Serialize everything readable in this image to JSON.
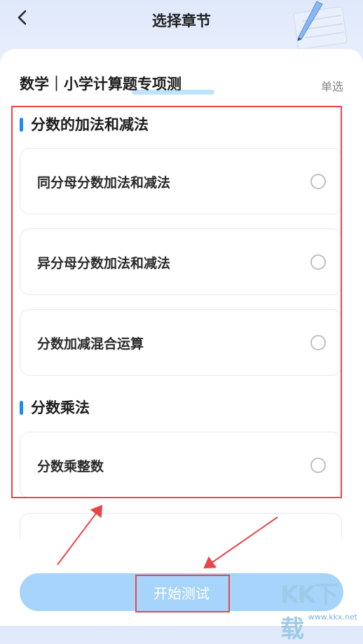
{
  "header": {
    "title": "选择章节",
    "back_icon": "chevron-left-icon",
    "decoration_icon": "pen-icon"
  },
  "subject": {
    "title": "数学｜小学计算题专项测",
    "mode": "单选"
  },
  "sections": [
    {
      "label": "分数的加法和减法",
      "items": [
        {
          "label": "同分母分数加法和减法",
          "selected": false
        },
        {
          "label": "异分母分数加法和减法",
          "selected": false
        },
        {
          "label": "分数加减混合运算",
          "selected": false
        }
      ]
    },
    {
      "label": "分数乘法",
      "items": [
        {
          "label": "分数乘整数",
          "selected": false
        }
      ]
    }
  ],
  "footer": {
    "start_label": "开始测试"
  },
  "watermark": {
    "text": "KK下载",
    "url": "www.kkx.net"
  },
  "colors": {
    "accent": "#1a8cf5",
    "button": "#a7d4fb",
    "annotation": "#e8454a"
  }
}
